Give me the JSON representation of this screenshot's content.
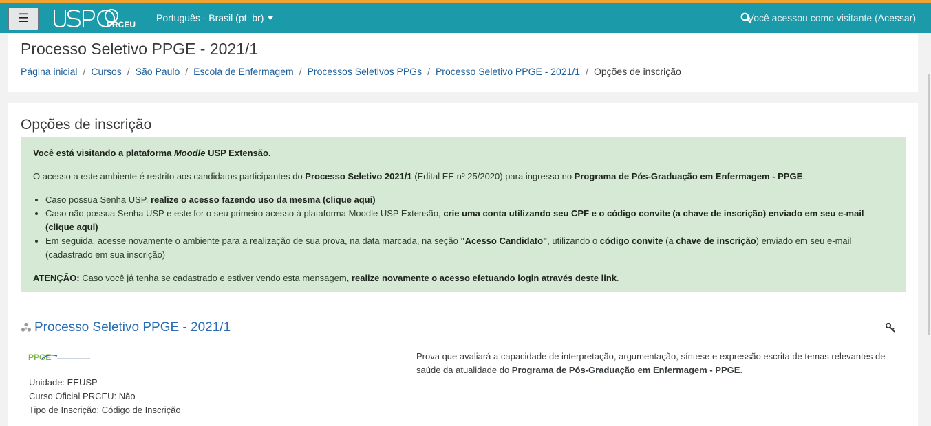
{
  "topbar": {
    "logo_text": "USP PRCEU",
    "language": "Português - Brasil (pt_br)",
    "visitor_text": "Você acessou como visitante (",
    "login_link": "Acessar",
    "visitor_close": ")"
  },
  "header": {
    "title": "Processo Seletivo PPGE - 2021/1",
    "breadcrumb": [
      "Página inicial",
      "Cursos",
      "São Paulo",
      "Escola de Enfermagem",
      "Processos Seletivos PPGs",
      "Processo Seletivo PPGE - 2021/1",
      "Opções de inscrição"
    ]
  },
  "main": {
    "section_title": "Opções de inscrição",
    "notice": {
      "intro_a": "Você está visitando a plataforma ",
      "intro_em": "Moodle",
      "intro_b": " USP Extensão.",
      "p2_a": "O acesso a este ambiente é restrito aos candidatos participantes do ",
      "p2_b": "Processo Seletivo 2021/1",
      "p2_c": " (Edital EE nº 25/2020) para ingresso no ",
      "p2_d": "Programa de Pós-Graduação em Enfermagem - PPGE",
      "p2_e": ".",
      "li1_a": "Caso possua Senha USP, ",
      "li1_b": "realize o acesso fazendo uso da mesma (clique aqui)",
      "li2_a": "Caso não possua Senha USP e este for o seu primeiro acesso à plataforma Moodle USP Extensão, ",
      "li2_b": "crie uma conta utilizando seu CPF e o código convite (a chave de inscrição) enviado em seu e-mail (clique aqui)",
      "li3_a": "Em seguida, acesse novamente o ambiente para a realização de sua prova, na data marcada, na seção ",
      "li3_b": "\"Acesso Candidato\"",
      "li3_c": ", utilizando o ",
      "li3_d": "código convite",
      "li3_e": " (a ",
      "li3_f": "chave de inscrição",
      "li3_g": ") enviado em seu e-mail (cadastrado em sua inscrição)",
      "att_a": "ATENÇÃO:",
      "att_b": " Caso você já tenha se cadastrado e estiver vendo esta mensagem, ",
      "att_c": "realize novamente o acesso efetuando login através deste link",
      "att_d": "."
    },
    "course": {
      "title": "Processo Seletivo PPGE - 2021/1",
      "logo_text": "PPGE",
      "unit": "Unidade: EEUSP",
      "official": "Curso Oficial PRCEU: Não",
      "enrol_type": "Tipo de Inscrição: Código de Inscrição",
      "summary_a": "Prova que avaliará a capacidade de interpretação, argumentação, síntese e expressão escrita de temas relevantes de saúde da atualidade do ",
      "summary_b": "Programa de Pós-Graduação em Enfermagem - PPGE",
      "summary_c": "."
    }
  },
  "colors": {
    "navbar": "#1b9aaa",
    "accent_top": "#f0a330",
    "link": "#1f5f9a",
    "notice_bg": "#d6e9d4"
  },
  "icons": [
    "menu-icon",
    "search-icon",
    "course-icon",
    "key-icon"
  ]
}
